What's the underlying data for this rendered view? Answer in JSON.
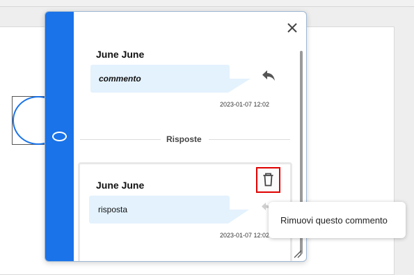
{
  "comment_panel": {
    "main_comment": {
      "author": "June June",
      "text": "commento",
      "timestamp": "2023-01-07 12:02",
      "reply_icon": "reply-icon"
    },
    "replies_label": "Risposte",
    "replies": [
      {
        "author": "June June",
        "text": "risposta",
        "timestamp": "2023-01-07 12:02",
        "delete_icon": "trash-icon"
      }
    ],
    "close_icon": "close-icon",
    "accent_color": "#1a73e8",
    "bubble_color": "#e3f2fd",
    "highlight_color": "#e00000"
  },
  "tooltip": {
    "text": "Rimuovi questo commento"
  }
}
